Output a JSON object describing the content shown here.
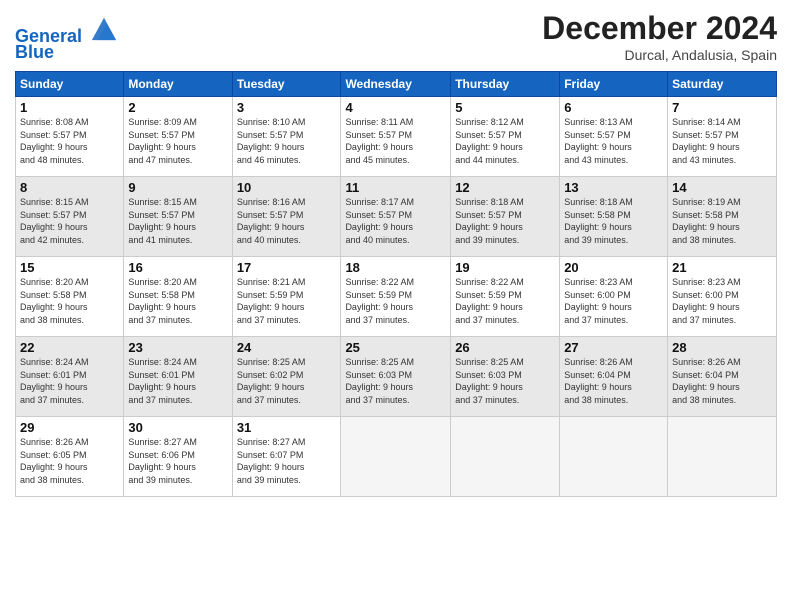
{
  "logo": {
    "line1": "General",
    "line2": "Blue"
  },
  "title": "December 2024",
  "subtitle": "Durcal, Andalusia, Spain",
  "headers": [
    "Sunday",
    "Monday",
    "Tuesday",
    "Wednesday",
    "Thursday",
    "Friday",
    "Saturday"
  ],
  "weeks": [
    [
      {
        "day": "1",
        "info": "Sunrise: 8:08 AM\nSunset: 5:57 PM\nDaylight: 9 hours\nand 48 minutes."
      },
      {
        "day": "2",
        "info": "Sunrise: 8:09 AM\nSunset: 5:57 PM\nDaylight: 9 hours\nand 47 minutes."
      },
      {
        "day": "3",
        "info": "Sunrise: 8:10 AM\nSunset: 5:57 PM\nDaylight: 9 hours\nand 46 minutes."
      },
      {
        "day": "4",
        "info": "Sunrise: 8:11 AM\nSunset: 5:57 PM\nDaylight: 9 hours\nand 45 minutes."
      },
      {
        "day": "5",
        "info": "Sunrise: 8:12 AM\nSunset: 5:57 PM\nDaylight: 9 hours\nand 44 minutes."
      },
      {
        "day": "6",
        "info": "Sunrise: 8:13 AM\nSunset: 5:57 PM\nDaylight: 9 hours\nand 43 minutes."
      },
      {
        "day": "7",
        "info": "Sunrise: 8:14 AM\nSunset: 5:57 PM\nDaylight: 9 hours\nand 43 minutes."
      }
    ],
    [
      {
        "day": "8",
        "info": "Sunrise: 8:15 AM\nSunset: 5:57 PM\nDaylight: 9 hours\nand 42 minutes."
      },
      {
        "day": "9",
        "info": "Sunrise: 8:15 AM\nSunset: 5:57 PM\nDaylight: 9 hours\nand 41 minutes."
      },
      {
        "day": "10",
        "info": "Sunrise: 8:16 AM\nSunset: 5:57 PM\nDaylight: 9 hours\nand 40 minutes."
      },
      {
        "day": "11",
        "info": "Sunrise: 8:17 AM\nSunset: 5:57 PM\nDaylight: 9 hours\nand 40 minutes."
      },
      {
        "day": "12",
        "info": "Sunrise: 8:18 AM\nSunset: 5:57 PM\nDaylight: 9 hours\nand 39 minutes."
      },
      {
        "day": "13",
        "info": "Sunrise: 8:18 AM\nSunset: 5:58 PM\nDaylight: 9 hours\nand 39 minutes."
      },
      {
        "day": "14",
        "info": "Sunrise: 8:19 AM\nSunset: 5:58 PM\nDaylight: 9 hours\nand 38 minutes."
      }
    ],
    [
      {
        "day": "15",
        "info": "Sunrise: 8:20 AM\nSunset: 5:58 PM\nDaylight: 9 hours\nand 38 minutes."
      },
      {
        "day": "16",
        "info": "Sunrise: 8:20 AM\nSunset: 5:58 PM\nDaylight: 9 hours\nand 37 minutes."
      },
      {
        "day": "17",
        "info": "Sunrise: 8:21 AM\nSunset: 5:59 PM\nDaylight: 9 hours\nand 37 minutes."
      },
      {
        "day": "18",
        "info": "Sunrise: 8:22 AM\nSunset: 5:59 PM\nDaylight: 9 hours\nand 37 minutes."
      },
      {
        "day": "19",
        "info": "Sunrise: 8:22 AM\nSunset: 5:59 PM\nDaylight: 9 hours\nand 37 minutes."
      },
      {
        "day": "20",
        "info": "Sunrise: 8:23 AM\nSunset: 6:00 PM\nDaylight: 9 hours\nand 37 minutes."
      },
      {
        "day": "21",
        "info": "Sunrise: 8:23 AM\nSunset: 6:00 PM\nDaylight: 9 hours\nand 37 minutes."
      }
    ],
    [
      {
        "day": "22",
        "info": "Sunrise: 8:24 AM\nSunset: 6:01 PM\nDaylight: 9 hours\nand 37 minutes."
      },
      {
        "day": "23",
        "info": "Sunrise: 8:24 AM\nSunset: 6:01 PM\nDaylight: 9 hours\nand 37 minutes."
      },
      {
        "day": "24",
        "info": "Sunrise: 8:25 AM\nSunset: 6:02 PM\nDaylight: 9 hours\nand 37 minutes."
      },
      {
        "day": "25",
        "info": "Sunrise: 8:25 AM\nSunset: 6:03 PM\nDaylight: 9 hours\nand 37 minutes."
      },
      {
        "day": "26",
        "info": "Sunrise: 8:25 AM\nSunset: 6:03 PM\nDaylight: 9 hours\nand 37 minutes."
      },
      {
        "day": "27",
        "info": "Sunrise: 8:26 AM\nSunset: 6:04 PM\nDaylight: 9 hours\nand 38 minutes."
      },
      {
        "day": "28",
        "info": "Sunrise: 8:26 AM\nSunset: 6:04 PM\nDaylight: 9 hours\nand 38 minutes."
      }
    ],
    [
      {
        "day": "29",
        "info": "Sunrise: 8:26 AM\nSunset: 6:05 PM\nDaylight: 9 hours\nand 38 minutes."
      },
      {
        "day": "30",
        "info": "Sunrise: 8:27 AM\nSunset: 6:06 PM\nDaylight: 9 hours\nand 39 minutes."
      },
      {
        "day": "31",
        "info": "Sunrise: 8:27 AM\nSunset: 6:07 PM\nDaylight: 9 hours\nand 39 minutes."
      },
      null,
      null,
      null,
      null
    ]
  ]
}
